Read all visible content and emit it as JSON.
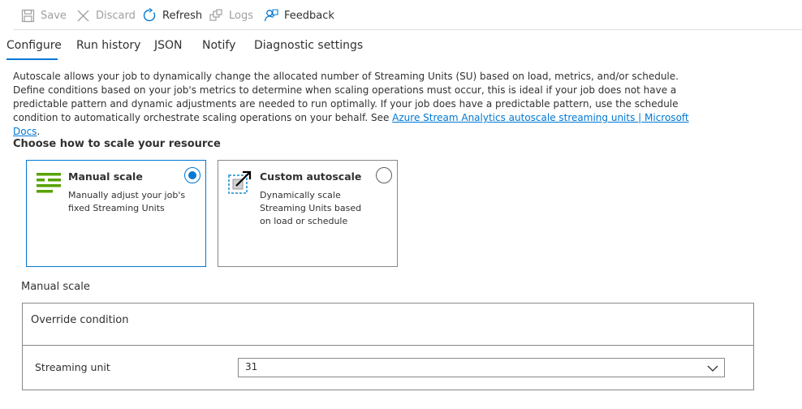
{
  "toolbar": {
    "save": "Save",
    "discard": "Discard",
    "refresh": "Refresh",
    "logs": "Logs",
    "feedback": "Feedback"
  },
  "tabs": [
    {
      "label": "Configure",
      "active": true
    },
    {
      "label": "Run history",
      "active": false
    },
    {
      "label": "JSON",
      "active": false
    },
    {
      "label": "Notify",
      "active": false
    },
    {
      "label": "Diagnostic settings",
      "active": false
    }
  ],
  "description": {
    "text": "Autoscale allows your job to dynamically change the allocated number of Streaming Units (SU) based on load, metrics, and/or schedule. Define conditions based on your job's metrics to determine when scaling operations must occur, this is ideal if your job does not have a predictable pattern and dynamic adjustments are needed to run optimally. If your job does have a predictable pattern, use the schedule condition to automatically orchestrate scaling operations on your behalf. See ",
    "link": "Azure Stream Analytics autoscale streaming units | Microsoft Docs",
    "suffix": "."
  },
  "scale_section": {
    "title": "Choose how to scale your resource",
    "options": [
      {
        "title": "Manual scale",
        "description": "Manually adjust your job's fixed Streaming Units",
        "selected": true
      },
      {
        "title": "Custom autoscale",
        "description": "Dynamically scale Streaming Units based on load or schedule",
        "selected": false
      }
    ]
  },
  "manual_scale": {
    "label": "Manual scale",
    "override_condition": "Override condition",
    "streaming_unit_label": "Streaming unit",
    "streaming_unit_value": "31"
  },
  "colors": {
    "accent": "#0078d4",
    "manual_icon": "#57a300",
    "autoscale_icon": "#50a7d8"
  }
}
